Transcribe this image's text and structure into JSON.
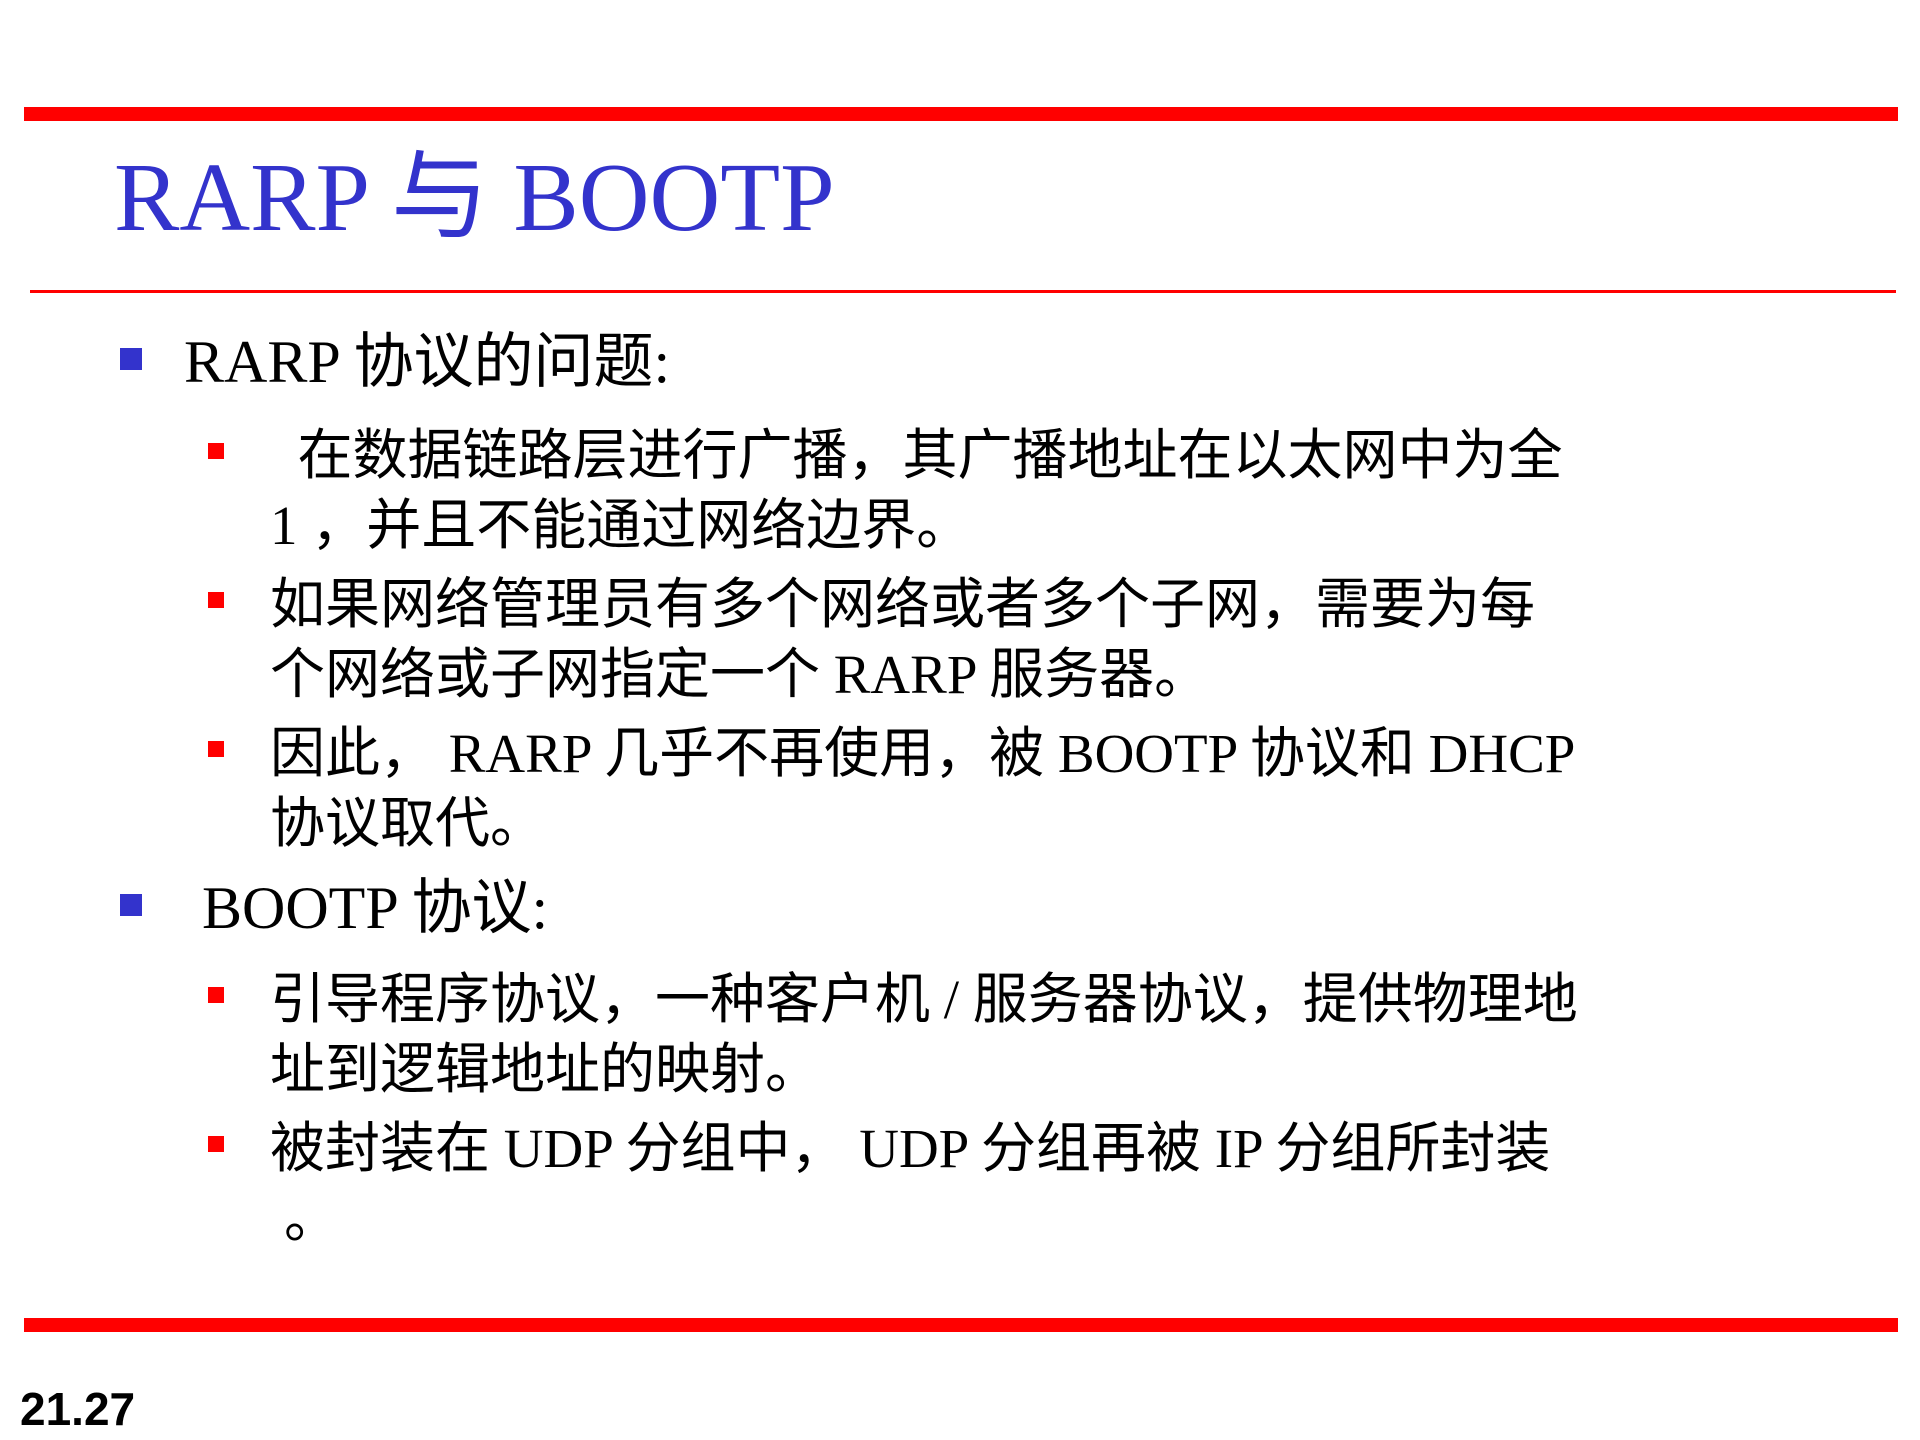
{
  "slide": {
    "title": "RARP 与 BOOTP",
    "sections": [
      {
        "heading": "RARP 协议的问题:",
        "items": [
          {
            "lines": [
              "  在数据链路层进行广播，其广播地址在以太网中为全",
              "1 ，并且不能通过网络边界。"
            ]
          },
          {
            "lines": [
              "如果网络管理员有多个网络或者多个子网，需要为每",
              "个网络或子网指定一个 RARP 服务器。"
            ]
          },
          {
            "lines": [
              "因此， RARP 几乎不再使用，被 BOOTP 协议和 DHCP",
              "协议取代。"
            ]
          }
        ]
      },
      {
        "heading": "BOOTP 协议:",
        "items": [
          {
            "lines": [
              "引导程序协议，一种客户机 / 服务器协议，提供物理地",
              "址到逻辑地址的映射。"
            ]
          },
          {
            "lines": [
              "被封装在 UDP 分组中， UDP 分组再被 IP 分组所封装",
              "。"
            ]
          }
        ]
      }
    ],
    "page_number": "21.27",
    "colors": {
      "title": "#3333cc",
      "rule": "#ff0000",
      "level1_bullet": "#3333cc",
      "level2_bullet": "#ff0000",
      "text": "#000000"
    }
  }
}
